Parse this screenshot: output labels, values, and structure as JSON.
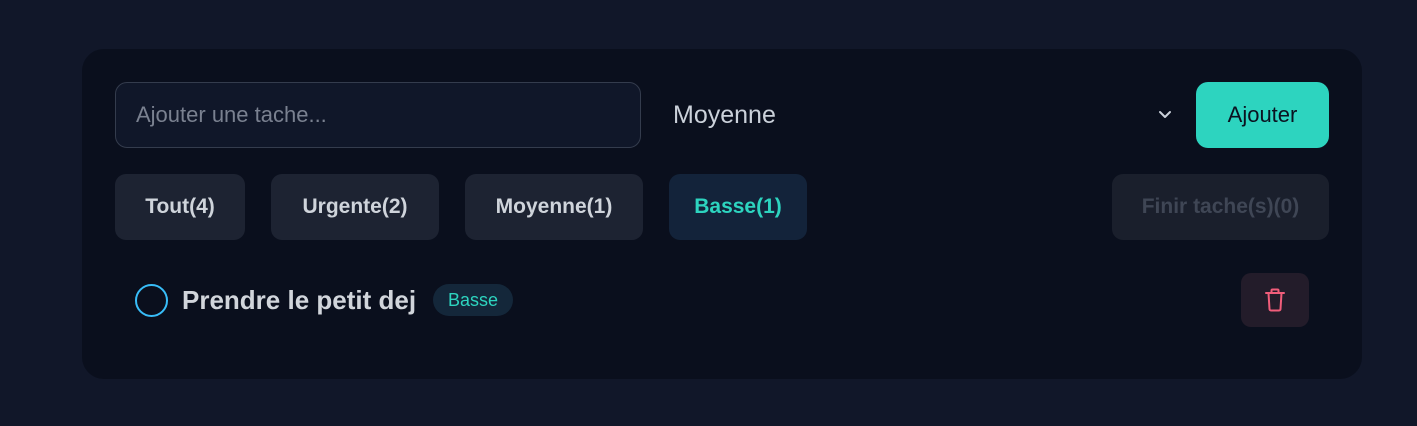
{
  "form": {
    "task_placeholder": "Ajouter une tache...",
    "task_value": "",
    "priority_selected": "Moyenne",
    "add_label": "Ajouter"
  },
  "filters": [
    {
      "label": "Tout(4)",
      "active": false
    },
    {
      "label": "Urgente(2)",
      "active": false
    },
    {
      "label": "Moyenne(1)",
      "active": false
    },
    {
      "label": "Basse(1)",
      "active": true
    }
  ],
  "finish_label": "Finir tache(s)(0)",
  "tasks": [
    {
      "title": "Prendre le petit dej",
      "priority": "Basse",
      "done": false
    }
  ],
  "icons": {
    "select_arrow": "chevron-down-icon",
    "delete": "trash-icon"
  },
  "colors": {
    "accent": "#2dd4bf",
    "checkbox": "#38bdf8",
    "delete": "#f05d7a",
    "background": "#111729",
    "card": "#0a0f1d"
  }
}
